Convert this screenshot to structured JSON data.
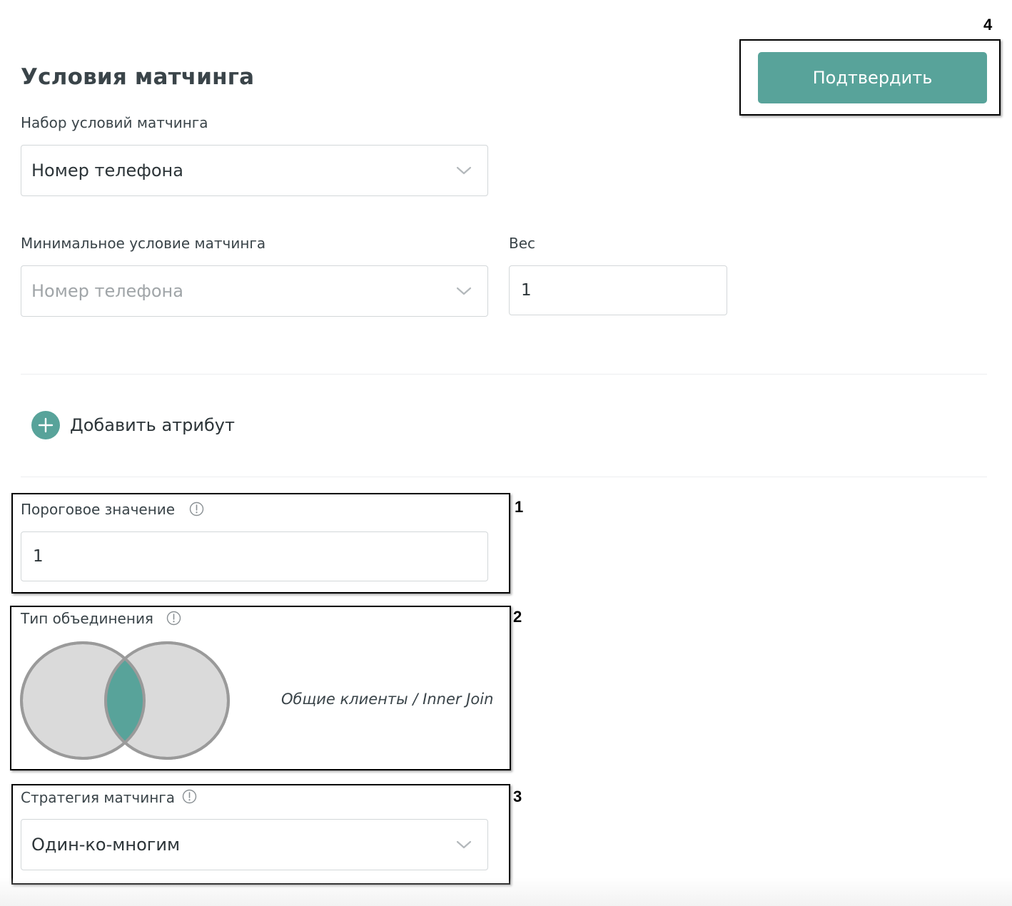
{
  "header": {
    "title": "Условия матчинга",
    "confirm_label": "Подтвердить"
  },
  "matching_set": {
    "label": "Набор условий матчинга",
    "value": "Номер телефона"
  },
  "min_condition": {
    "label": "Минимальное условие матчинга",
    "value": "Номер телефона"
  },
  "weight": {
    "label": "Вес",
    "value": "1"
  },
  "add_attribute": {
    "label": "Добавить атрибут"
  },
  "threshold": {
    "label": "Пороговое значение",
    "value": "1"
  },
  "join_type": {
    "label": "Тип объединения",
    "caption": "Общие клиенты / Inner Join"
  },
  "strategy": {
    "label": "Стратегия матчинга",
    "value": "Один-ко-многим"
  },
  "annotations": [
    "1",
    "2",
    "3",
    "4"
  ],
  "colors": {
    "accent": "#58a39a",
    "border": "#d3d7d9",
    "text": "#3a4449",
    "venn_fill": "#dadada",
    "venn_stroke": "#9a9a9a"
  },
  "icons": [
    "chevron-down-icon",
    "plus-icon",
    "info-icon"
  ]
}
